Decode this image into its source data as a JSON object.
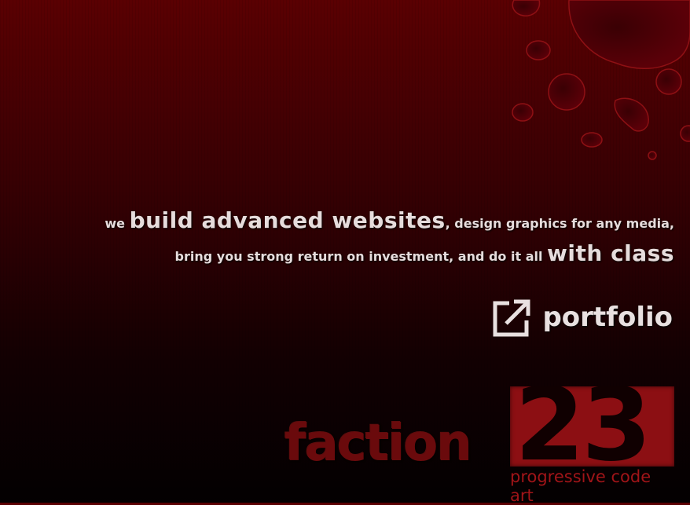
{
  "tagline": {
    "we": "we",
    "build": "build advanced websites",
    "design": ", design graphics for any media,",
    "bring": "bring you strong return on investment, and do it all",
    "class": "with class"
  },
  "portfolio": {
    "label": "portfolio",
    "icon": "external-link-icon"
  },
  "logo": {
    "word": "faction",
    "number": "23",
    "tagline": "progressive code art"
  },
  "colors": {
    "background_top": "#5a0002",
    "background_bottom": "#030001",
    "accent": "#8c0f13",
    "text": "#e6dcdc"
  }
}
